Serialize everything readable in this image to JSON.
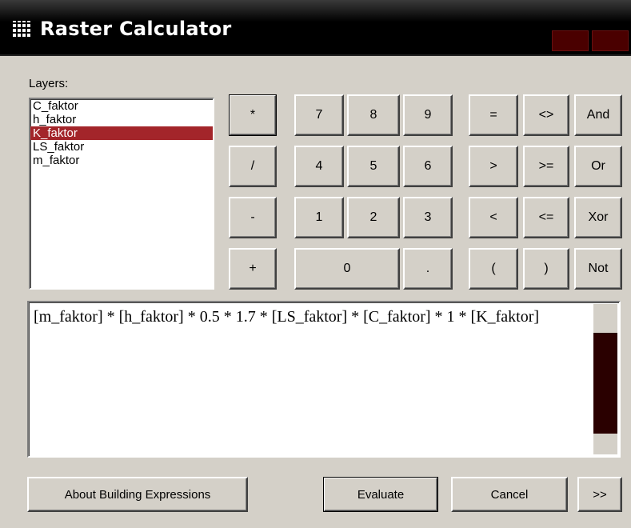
{
  "window": {
    "title": "Raster Calculator"
  },
  "layers": {
    "label": "Layers:",
    "items": [
      "C_faktor",
      "h_faktor",
      "K_faktor",
      "LS_faktor",
      "m_faktor"
    ],
    "selected_index": 2
  },
  "keypad": {
    "ops": [
      "*",
      "/",
      "-",
      "+"
    ],
    "row1": [
      "7",
      "8",
      "9"
    ],
    "row2": [
      "4",
      "5",
      "6"
    ],
    "row3": [
      "1",
      "2",
      "3"
    ],
    "zero": "0",
    "dot": ".",
    "cmp_row1": [
      "=",
      "<>",
      "And"
    ],
    "cmp_row2": [
      ">",
      ">=",
      "Or"
    ],
    "cmp_row3": [
      "<",
      "<=",
      "Xor"
    ],
    "cmp_row4": [
      "(",
      ")",
      "Not"
    ]
  },
  "expression": "[m_faktor] * [h_faktor] * 0.5 * 1.7 * [LS_faktor] * [C_faktor] * 1 * [K_faktor]",
  "footer": {
    "about_label": "About Building Expressions",
    "evaluate_label": "Evaluate",
    "cancel_label": "Cancel",
    "more_label": ">>"
  }
}
